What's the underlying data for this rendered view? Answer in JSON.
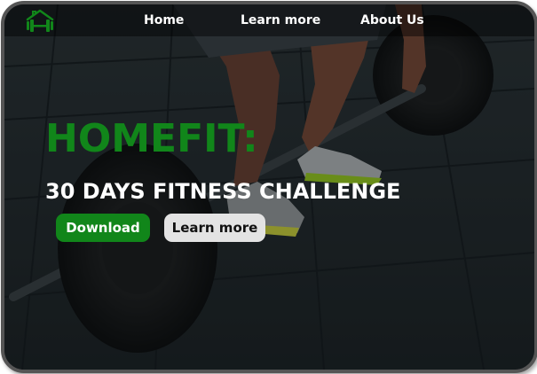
{
  "colors": {
    "brand_green": "#11861a",
    "nav_text": "#ffffff",
    "secondary_button_bg": "#e3e3e3"
  },
  "nav": {
    "logo_icon": "dumbbell-house-icon",
    "links": [
      "Home",
      "Learn more",
      "About Us"
    ]
  },
  "hero": {
    "background_image": "barbell-deadlift-photo",
    "title": "HOMEFIT:",
    "subtitle": "30 DAYS FITNESS CHALLENGE",
    "primary_button": "Download",
    "secondary_button": "Learn more"
  }
}
